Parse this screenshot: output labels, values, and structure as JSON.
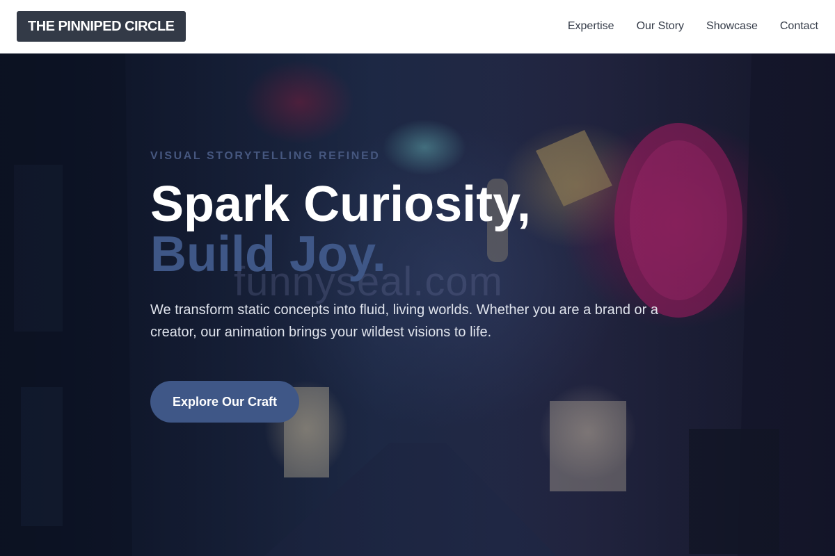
{
  "header": {
    "logo": "THE PINNIPED CIRCLE",
    "nav": [
      {
        "label": "Expertise"
      },
      {
        "label": "Our Story"
      },
      {
        "label": "Showcase"
      },
      {
        "label": "Contact"
      }
    ]
  },
  "hero": {
    "eyebrow": "VISUAL STORYTELLING REFINED",
    "headline_line1": "Spark Curiosity,",
    "headline_line2": "Build Joy.",
    "watermark": "funnyseal.com",
    "description": "We transform static concepts into fluid, living worlds. Whether you are a brand or a creator, our animation brings your wildest visions to life.",
    "cta_label": "Explore Our Craft"
  },
  "colors": {
    "accent": "#3f5787",
    "logo_bg": "#333a47",
    "nav_text": "#333a47"
  }
}
